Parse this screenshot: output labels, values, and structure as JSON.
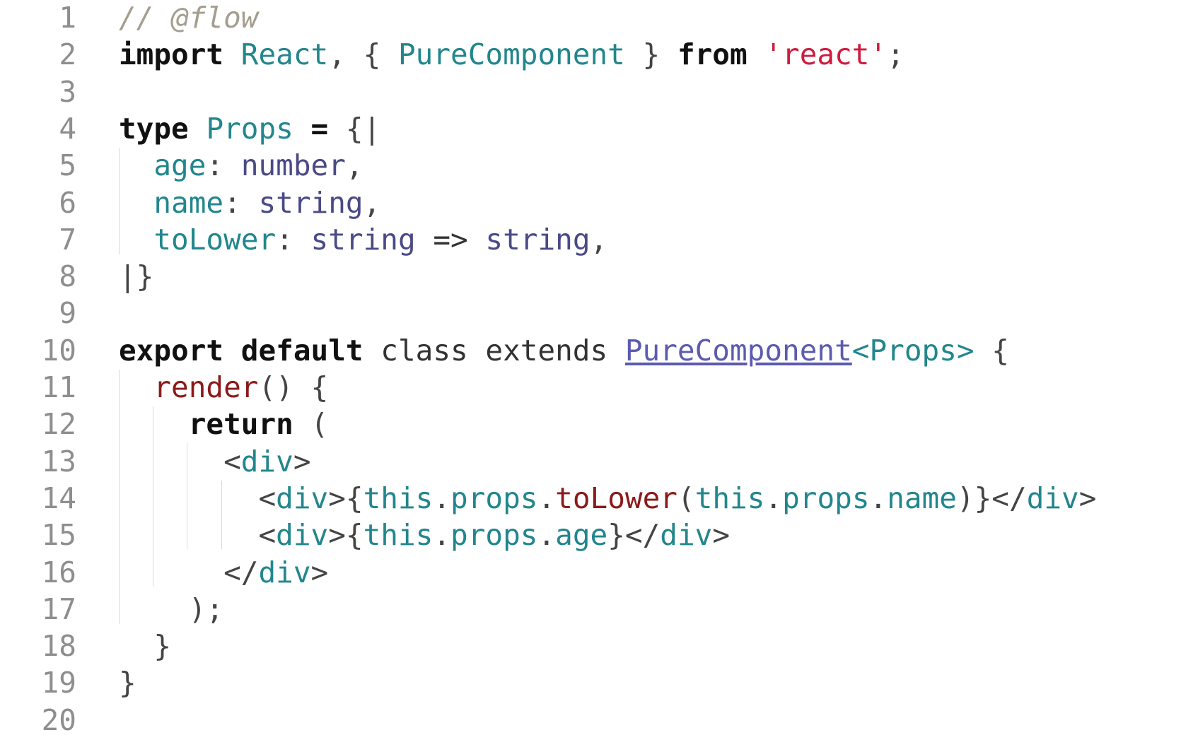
{
  "editor": {
    "language": "javascript-flow",
    "colors": {
      "comment": "#a39e8f",
      "keyword": "#111111",
      "definition": "#22868d",
      "string": "#cf1b3f",
      "type": "#4a4a86",
      "function_call": "#8b1a1a",
      "link": "#5b5bb0",
      "line_number": "#8e8e8e",
      "indent_guide": "#d9d9d9"
    },
    "lines": [
      {
        "num": "1",
        "tokens": [
          {
            "c": "t-comment",
            "t": "// @flow"
          }
        ]
      },
      {
        "num": "2",
        "tokens": [
          {
            "c": "t-kw",
            "t": "import"
          },
          {
            "c": "t-plain",
            "t": " "
          },
          {
            "c": "t-def",
            "t": "React"
          },
          {
            "c": "t-punc",
            "t": ", { "
          },
          {
            "c": "t-def",
            "t": "PureComponent"
          },
          {
            "c": "t-punc",
            "t": " } "
          },
          {
            "c": "t-kw",
            "t": "from"
          },
          {
            "c": "t-plain",
            "t": " "
          },
          {
            "c": "t-str",
            "t": "'react'"
          },
          {
            "c": "t-punc",
            "t": ";"
          }
        ]
      },
      {
        "num": "3",
        "tokens": []
      },
      {
        "num": "4",
        "tokens": [
          {
            "c": "t-kw",
            "t": "type"
          },
          {
            "c": "t-plain",
            "t": " "
          },
          {
            "c": "t-def",
            "t": "Props"
          },
          {
            "c": "t-plain",
            "t": " "
          },
          {
            "c": "t-kw",
            "t": "="
          },
          {
            "c": "t-punc",
            "t": " {|"
          }
        ]
      },
      {
        "num": "5",
        "tokens": [
          {
            "c": "t-plain",
            "t": "  "
          },
          {
            "c": "t-def",
            "t": "age"
          },
          {
            "c": "t-punc",
            "t": ": "
          },
          {
            "c": "t-type",
            "t": "number"
          },
          {
            "c": "t-punc",
            "t": ","
          }
        ]
      },
      {
        "num": "6",
        "tokens": [
          {
            "c": "t-plain",
            "t": "  "
          },
          {
            "c": "t-def",
            "t": "name"
          },
          {
            "c": "t-punc",
            "t": ": "
          },
          {
            "c": "t-type",
            "t": "string"
          },
          {
            "c": "t-punc",
            "t": ","
          }
        ]
      },
      {
        "num": "7",
        "tokens": [
          {
            "c": "t-plain",
            "t": "  "
          },
          {
            "c": "t-def",
            "t": "toLower"
          },
          {
            "c": "t-punc",
            "t": ": "
          },
          {
            "c": "t-type",
            "t": "string"
          },
          {
            "c": "t-plain",
            "t": " => "
          },
          {
            "c": "t-type",
            "t": "string"
          },
          {
            "c": "t-punc",
            "t": ","
          }
        ]
      },
      {
        "num": "8",
        "tokens": [
          {
            "c": "t-punc",
            "t": "|}"
          }
        ]
      },
      {
        "num": "9",
        "tokens": []
      },
      {
        "num": "10",
        "tokens": [
          {
            "c": "t-kw",
            "t": "export"
          },
          {
            "c": "t-plain",
            "t": " "
          },
          {
            "c": "t-kw",
            "t": "default"
          },
          {
            "c": "t-plain",
            "t": " class extends "
          },
          {
            "c": "t-link",
            "t": "PureComponent"
          },
          {
            "c": "t-tag",
            "t": "<Props>"
          },
          {
            "c": "t-punc",
            "t": " {"
          }
        ]
      },
      {
        "num": "11",
        "tokens": [
          {
            "c": "t-plain",
            "t": "  "
          },
          {
            "c": "t-fn",
            "t": "render"
          },
          {
            "c": "t-punc",
            "t": "() {"
          }
        ]
      },
      {
        "num": "12",
        "tokens": [
          {
            "c": "t-plain",
            "t": "    "
          },
          {
            "c": "t-kw",
            "t": "return"
          },
          {
            "c": "t-punc",
            "t": " ("
          }
        ]
      },
      {
        "num": "13",
        "tokens": [
          {
            "c": "t-plain",
            "t": "      "
          },
          {
            "c": "t-punc",
            "t": "<"
          },
          {
            "c": "t-tag",
            "t": "div"
          },
          {
            "c": "t-punc",
            "t": ">"
          }
        ]
      },
      {
        "num": "14",
        "tokens": [
          {
            "c": "t-plain",
            "t": "        "
          },
          {
            "c": "t-punc",
            "t": "<"
          },
          {
            "c": "t-tag",
            "t": "div"
          },
          {
            "c": "t-punc",
            "t": ">{"
          },
          {
            "c": "t-tag",
            "t": "this"
          },
          {
            "c": "t-punc",
            "t": "."
          },
          {
            "c": "t-tag",
            "t": "props"
          },
          {
            "c": "t-punc",
            "t": "."
          },
          {
            "c": "t-fn",
            "t": "toLower"
          },
          {
            "c": "t-punc",
            "t": "("
          },
          {
            "c": "t-tag",
            "t": "this"
          },
          {
            "c": "t-punc",
            "t": "."
          },
          {
            "c": "t-tag",
            "t": "props"
          },
          {
            "c": "t-punc",
            "t": "."
          },
          {
            "c": "t-tag",
            "t": "name"
          },
          {
            "c": "t-punc",
            "t": ")}</"
          },
          {
            "c": "t-tag",
            "t": "div"
          },
          {
            "c": "t-punc",
            "t": ">"
          }
        ]
      },
      {
        "num": "15",
        "tokens": [
          {
            "c": "t-plain",
            "t": "        "
          },
          {
            "c": "t-punc",
            "t": "<"
          },
          {
            "c": "t-tag",
            "t": "div"
          },
          {
            "c": "t-punc",
            "t": ">{"
          },
          {
            "c": "t-tag",
            "t": "this"
          },
          {
            "c": "t-punc",
            "t": "."
          },
          {
            "c": "t-tag",
            "t": "props"
          },
          {
            "c": "t-punc",
            "t": "."
          },
          {
            "c": "t-tag",
            "t": "age"
          },
          {
            "c": "t-punc",
            "t": "}</"
          },
          {
            "c": "t-tag",
            "t": "div"
          },
          {
            "c": "t-punc",
            "t": ">"
          }
        ]
      },
      {
        "num": "16",
        "tokens": [
          {
            "c": "t-plain",
            "t": "      "
          },
          {
            "c": "t-punc",
            "t": "</"
          },
          {
            "c": "t-tag",
            "t": "div"
          },
          {
            "c": "t-punc",
            "t": ">"
          }
        ]
      },
      {
        "num": "17",
        "tokens": [
          {
            "c": "t-plain",
            "t": "    "
          },
          {
            "c": "t-punc",
            "t": ");"
          }
        ]
      },
      {
        "num": "18",
        "tokens": [
          {
            "c": "t-plain",
            "t": "  "
          },
          {
            "c": "t-punc",
            "t": "}"
          }
        ]
      },
      {
        "num": "19",
        "tokens": [
          {
            "c": "t-punc",
            "t": "}"
          }
        ]
      },
      {
        "num": "20",
        "tokens": []
      }
    ]
  }
}
